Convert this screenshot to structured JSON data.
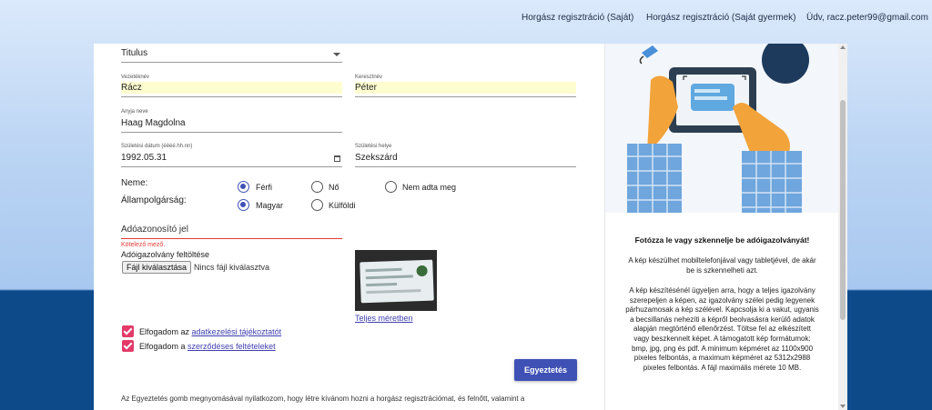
{
  "nav": {
    "link1": "Horgász regisztráció (Saját)",
    "link2": "Horgász regisztráció (Saját gyermek)",
    "greeting": "Üdv, racz.peter99@gmail.com"
  },
  "form": {
    "titulus": {
      "value": "Titulus"
    },
    "vezeteknev": {
      "label": "Vezetéknév",
      "value": "Rácz"
    },
    "keresztnev": {
      "label": "Keresztnév",
      "value": "Péter"
    },
    "anyja_neve": {
      "label": "Anyja neve",
      "value": "Haag Magdolna"
    },
    "szuletesi_datum": {
      "label": "Születési dátum (éééé.hh.nn)",
      "value": "1992.05.31"
    },
    "szuletesi_hely": {
      "label": "Születési helye",
      "value": "Szekszárd"
    },
    "neme": {
      "label": "Neme:",
      "options": [
        "Férfi",
        "Nő",
        "Nem adta meg"
      ],
      "selected": "Férfi"
    },
    "allampolgarsag": {
      "label": "Állampolgárság:",
      "options": [
        "Magyar",
        "Külföldi"
      ],
      "selected": "Magyar"
    },
    "adoazonosito": {
      "placeholder": "Adóazonosító jel",
      "error": "Kötelező mező."
    },
    "upload": {
      "label": "Adóigazolvány feltöltése",
      "button": "Fájl kiválasztása",
      "status": "Nincs fájl kiválasztva",
      "full_size_link": "Teljes méretben"
    },
    "consent1": {
      "prefix": "Elfogadom az ",
      "link": "adatkezelési tájékoztatót",
      "checked": true
    },
    "consent2": {
      "prefix": "Elfogadom a ",
      "link": "szerződéses feltételeket",
      "checked": true
    },
    "submit": "Egyeztetés",
    "declaration": "Az Egyeztetés gomb megnyomásával nyilatkozom, hogy létre kívánom hozni a horgász regisztrációmat, és felnőtt, valamint a"
  },
  "side": {
    "title": "Fotózza le vagy szkennelje be adóigazolványát!",
    "p1": "A kép készülhet mobiltelefonjával vagy tabletjével, de akár be is szkennelheti azt.",
    "p2": "A kép készítésénél ügyeljen arra, hogy a teljes igazolvány szerepeljen a képen, az igazolvány szélei pedig legyenek párhuzamosak a kép szélével. Kapcsolja ki a vakut, ugyanis a becsillanás nehezíti a képről beolvasásra kerülő adatok alapján megtörténő ellenőrzést. Töltse fel az elkészített vagy beszkennelt képet. A támogatott kép formátumok: bmp, jpg, png és pdf. A minimum képméret az 1100x900 pixeles felbontás, a maximum képméret az 5312x2988 pixeles felbontás. A fájl maximális mérete 10 MB."
  },
  "colors": {
    "primary": "#3f51b5",
    "checkbox": "#e33a6a",
    "error": "#e53935",
    "highlight": "#fdfdd0",
    "footer_band": "#0d4a8a"
  }
}
